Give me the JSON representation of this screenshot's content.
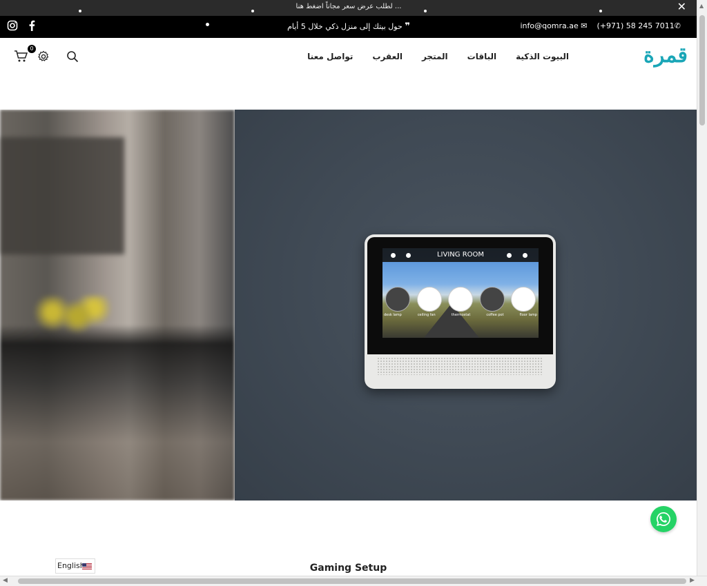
{
  "announcement": {
    "text": "لطلب عرض سعر مجاناً اضغط هنا ...",
    "close_icon": "close-icon"
  },
  "topbar": {
    "promo": "حول بيتك إلى منزل ذكي خلال 5 أيام",
    "email": "info@qomra.ae",
    "phone": "(+971) 58 245 7011",
    "social": [
      "instagram-icon",
      "facebook-icon"
    ]
  },
  "header": {
    "logo": "قمرة",
    "nav": [
      "البيوت الذكية",
      "الباقات",
      "المتجر",
      "العقرب",
      "تواصل معنا"
    ],
    "cart_count": "0"
  },
  "hero": {
    "device_screen_title": "LIVING ROOM",
    "device_labels": [
      "desk lamp",
      "ceiling fan",
      "thermostat",
      "coffee pot",
      "floor lamp"
    ]
  },
  "section": {
    "title": "Gaming Setup"
  },
  "language": {
    "label": "English"
  },
  "colors": {
    "brand": "#1aa6b7",
    "whatsapp": "#25d366",
    "topbar": "#000000",
    "announce": "#2b2b2b"
  }
}
